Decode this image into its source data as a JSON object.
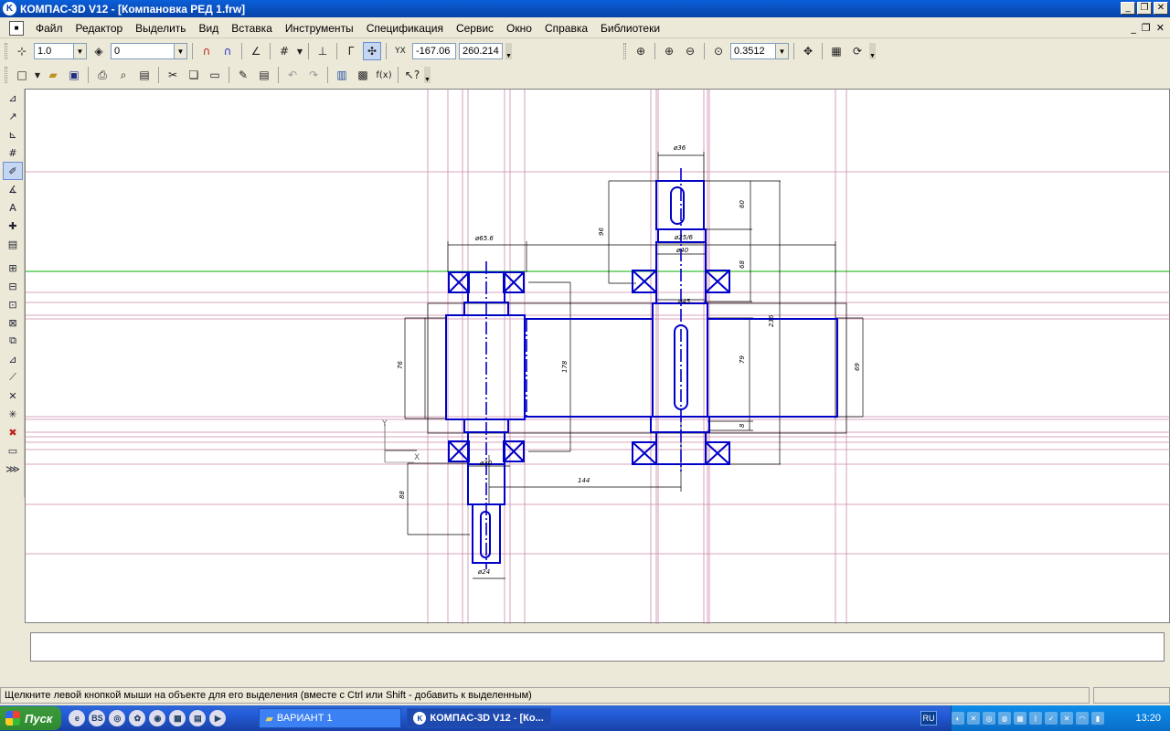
{
  "window": {
    "title": "КОМПАС-3D V12 - [Компановка РЕД 1.frw]",
    "app_icon_letter": "K"
  },
  "menu": {
    "items": [
      "Файл",
      "Редактор",
      "Выделить",
      "Вид",
      "Вставка",
      "Инструменты",
      "Спецификация",
      "Сервис",
      "Окно",
      "Справка",
      "Библиотеки"
    ]
  },
  "toolbar_top": {
    "step": "1.0",
    "layer": "0",
    "coord_x": "-167.06",
    "coord_y": "260.214",
    "zoom": "0.3512"
  },
  "drawing": {
    "dims": [
      "ø36",
      "ø25/6",
      "ø40",
      "ø45",
      "ø65.6",
      "ø30",
      "ø24",
      "60",
      "96",
      "68",
      "236",
      "79",
      "8",
      "178",
      "76",
      "69",
      "144",
      "88"
    ],
    "axis_labels": [
      "Y",
      "X"
    ]
  },
  "status": {
    "hint": "Щелкните левой кнопкой мыши на объекте для его выделения (вместе с Ctrl или Shift - добавить к выделенным)"
  },
  "taskbar": {
    "start_label": "Пуск",
    "tasks": [
      "ВАРИАНТ 1",
      "КОМПАС-3D V12 - [Ко..."
    ],
    "lang": "RU",
    "clock": "13:20"
  },
  "colors": {
    "outline": "#0000c8",
    "aux_line": "#cc88aa",
    "cursor_line": "#00b000"
  }
}
